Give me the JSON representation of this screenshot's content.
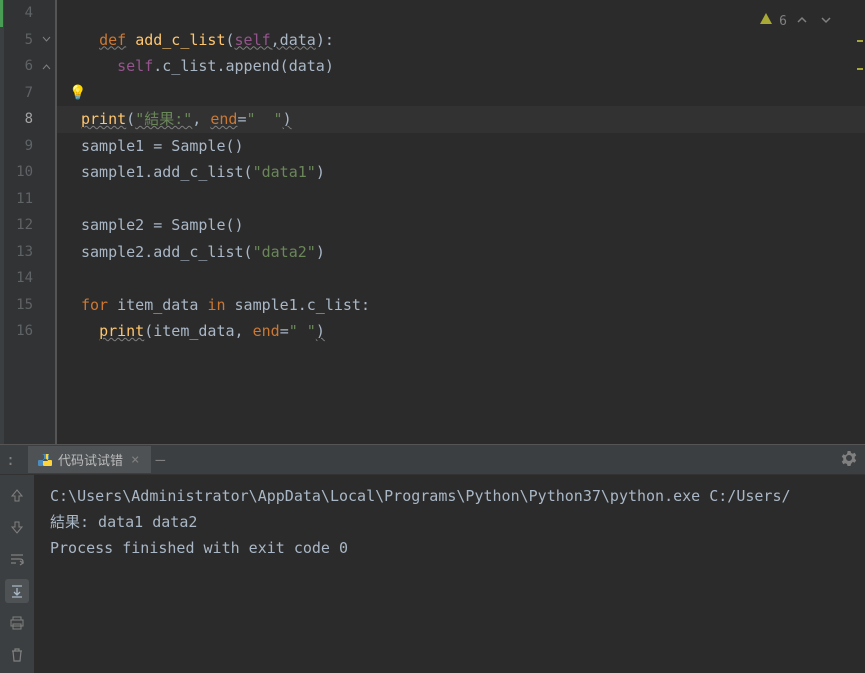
{
  "editor": {
    "warnings_count": "6",
    "lines": [
      {
        "n": "4",
        "content": ""
      },
      {
        "n": "5",
        "content": "def_add_c_list"
      },
      {
        "n": "6",
        "content": "self_c_list_append"
      },
      {
        "n": "7",
        "content": "bulb"
      },
      {
        "n": "8",
        "content": "print_result",
        "active": true
      },
      {
        "n": "9",
        "content": "sample1_assign"
      },
      {
        "n": "10",
        "content": "sample1_add"
      },
      {
        "n": "11",
        "content": ""
      },
      {
        "n": "12",
        "content": "sample2_assign"
      },
      {
        "n": "13",
        "content": "sample2_add"
      },
      {
        "n": "14",
        "content": ""
      },
      {
        "n": "15",
        "content": "for_loop"
      },
      {
        "n": "16",
        "content": "print_item"
      }
    ],
    "tokens": {
      "def": "def",
      "add_c_list": "add_c_list",
      "self": "self",
      "data": "data",
      "c_list": ".c_list.append(",
      "print": "print",
      "result_str": "\"結果:\"",
      "end": "end",
      "end_val": "\"  \"",
      "sample1": "sample1 = Sample()",
      "sample1_add": "sample1.add_c_list(",
      "data1": "\"data1\"",
      "sample2": "sample2 = Sample()",
      "sample2_add": "sample2.add_c_list(",
      "data2": "\"data2\"",
      "for": "for",
      "item_data": " item_data ",
      "in": "in",
      "sample1_clist": " sample1.c_list:",
      "print_item": "(item_data",
      "comma": ", ",
      "end_space": "\" \"",
      "paren_close": ")",
      "paren_open": "(",
      "colon": "):",
      "comma_data": ",data"
    }
  },
  "terminal": {
    "tab_title": "代码试试错",
    "output_line1": "C:\\Users\\Administrator\\AppData\\Local\\Programs\\Python\\Python37\\python.exe C:/Users/",
    "output_line2": "結果: data1 data2",
    "output_line3": "Process finished with exit code 0"
  },
  "icons": {
    "warning": "warning-triangle-icon",
    "chevron_up": "chevron-up-icon",
    "chevron_down": "chevron-down-icon",
    "bulb": "lightbulb-icon",
    "gear": "gear-icon",
    "python": "python-icon",
    "close": "close-icon",
    "minimize": "minimize-icon",
    "arrow_up": "arrow-up-icon",
    "arrow_down": "arrow-down-icon",
    "wrap": "soft-wrap-icon",
    "scroll_end": "scroll-to-end-icon",
    "print": "print-icon",
    "trash": "trash-icon"
  }
}
